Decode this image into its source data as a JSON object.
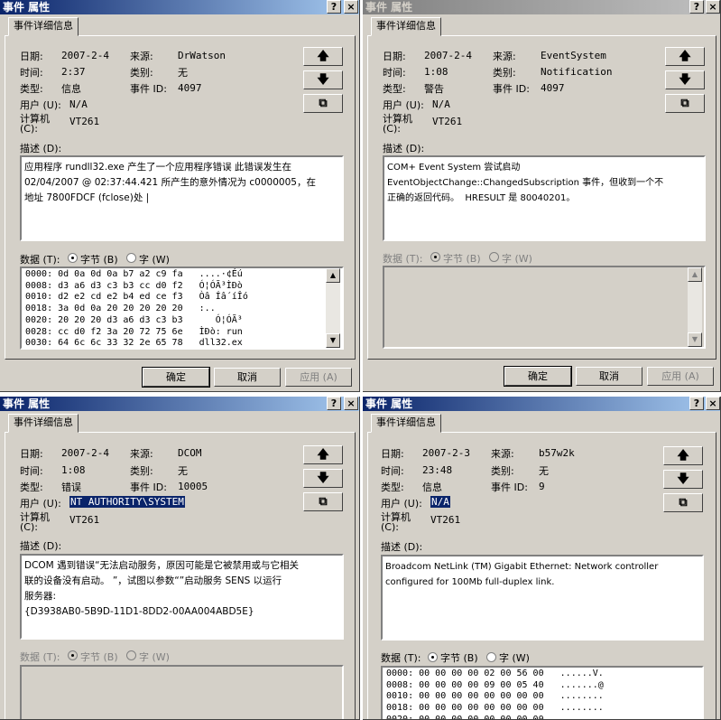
{
  "colors": {
    "title_left": "#0a246a",
    "title_right": "#a6caf0",
    "title_inactive_left": "#808080",
    "title_inactive_right": "#c0c0c0"
  },
  "labels": {
    "date": "日期:",
    "time": "时间:",
    "type": "类型:",
    "user": "用户 (U):",
    "computer": "计算机\n(C):",
    "source": "来源:",
    "category": "类别:",
    "event_id": "事件 ID:",
    "description": "描述 (D):",
    "data": "数据 (T):",
    "bytes": "字节 (B)",
    "words": "字 (W)"
  },
  "icons": {
    "up": "arrow-up-icon",
    "down": "arrow-down-icon",
    "copy": "copy-icon",
    "help": "help-icon",
    "close": "close-icon"
  },
  "dialogs": [
    {
      "title": "事件 属性",
      "tab": "事件详细信息",
      "date": "2007-2-4",
      "time": "2:37",
      "type": "信息",
      "user": "N/A",
      "computer": "VT261",
      "source": "DrWatson",
      "category": "无",
      "event_id": "4097",
      "description": "应用程序 rundll32.exe 产生了一个应用程序错误 此错误发生在\n02/04/2007 @ 02:37:44.421 所产生的意外情况为 c0000005，在\n地址 7800FDCF (fclose)处 |",
      "hex": "0000: 0d 0a 0d 0a b7 a2 c9 fa   ....·¢Éú\n0008: d3 a6 d3 c3 b3 cc d0 f2   Ó¦ÓÃ³ÌÐò\n0010: d2 e2 cd e2 b4 ed ce f3   Òâ Íâ´íÎó\n0018: 3a 0d 0a 20 20 20 20 20   :..\n0020: 20 20 20 d3 a6 d3 c3 b3      Ó¦ÓÃ³\n0028: cc d0 f2 3a 20 72 75 6e   ÌÐò: run\n0030: 64 6c 6c 33 32 2e 65 78   dll32.ex",
      "ok": "确定",
      "cancel": "取消",
      "apply": "应用 (A)"
    },
    {
      "title": "事件 属性",
      "tab": "事件详细信息",
      "date": "2007-2-4",
      "time": "1:08",
      "type": "警告",
      "user": "N/A",
      "computer": "VT261",
      "source": "EventSystem",
      "category": "Notification",
      "event_id": "4097",
      "description": "COM+ Event System 尝试启动\nEventObjectChange::ChangedSubscription 事件，但收到一个不\n正确的返回代码。  HRESULT 是 80040201。",
      "hex": "",
      "ok": "确定",
      "cancel": "取消",
      "apply": "应用 (A)"
    },
    {
      "title": "事件 属性",
      "tab": "事件详细信息",
      "date": "2007-2-4",
      "time": "1:08",
      "type": "错误",
      "user": "NT AUTHORITY\\SYSTEM",
      "computer": "VT261",
      "source": "DCOM",
      "category": "无",
      "event_id": "10005",
      "description": "DCOM 遇到错误“无法启动服务，原因可能是它被禁用或与它相关\n联的设备没有启动。 ”，试图以参数“”启动服务 SENS 以运行\n服务器:\n{D3938AB0-5B9D-11D1-8DD2-00AA004ABD5E}",
      "hex": ""
    },
    {
      "title": "事件 属性",
      "tab": "事件详细信息",
      "date": "2007-2-3",
      "time": "23:48",
      "type": "信息",
      "user": "N/A",
      "computer": "VT261",
      "source": "b57w2k",
      "category": "无",
      "event_id": "9",
      "description": "Broadcom NetLink (TM) Gigabit Ethernet: Network controller\nconfigured for 100Mb full-duplex link.",
      "hex": "0000: 00 00 00 00 02 00 56 00   ......V.\n0008: 00 00 00 00 09 00 05 40   .......@\n0010: 00 00 00 00 00 00 00 00   ........\n0018: 00 00 00 00 00 00 00 00   ........\n0020: 00 00 00 00 00 00 00 00"
    }
  ]
}
